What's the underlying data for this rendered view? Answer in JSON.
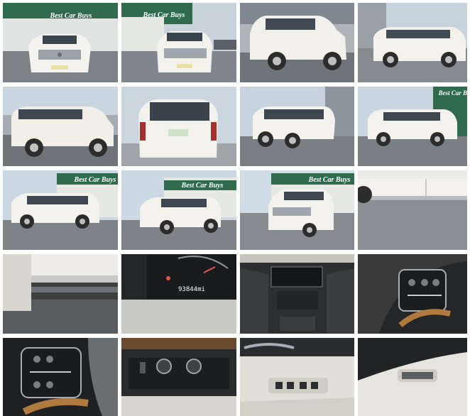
{
  "dealer_sign": "Best Car Buys",
  "odometer": "93844mi",
  "photos": [
    {
      "name": "photo-front-lot"
    },
    {
      "name": "photo-front-three-quarter"
    },
    {
      "name": "photo-side-lot"
    },
    {
      "name": "photo-rear-three-quarter"
    },
    {
      "name": "photo-side-street"
    },
    {
      "name": "photo-rear"
    },
    {
      "name": "photo-rear-side"
    },
    {
      "name": "photo-side-profile"
    },
    {
      "name": "photo-side-lot-2"
    },
    {
      "name": "photo-front-lot-2"
    },
    {
      "name": "photo-front-lot-3"
    },
    {
      "name": "photo-door-detail"
    },
    {
      "name": "photo-running-board"
    },
    {
      "name": "photo-odometer"
    },
    {
      "name": "photo-center-console"
    },
    {
      "name": "photo-steering-controls"
    },
    {
      "name": "photo-steering-controls-2"
    },
    {
      "name": "photo-seat-controls"
    },
    {
      "name": "photo-door-panel"
    },
    {
      "name": "photo-window-switch"
    }
  ]
}
